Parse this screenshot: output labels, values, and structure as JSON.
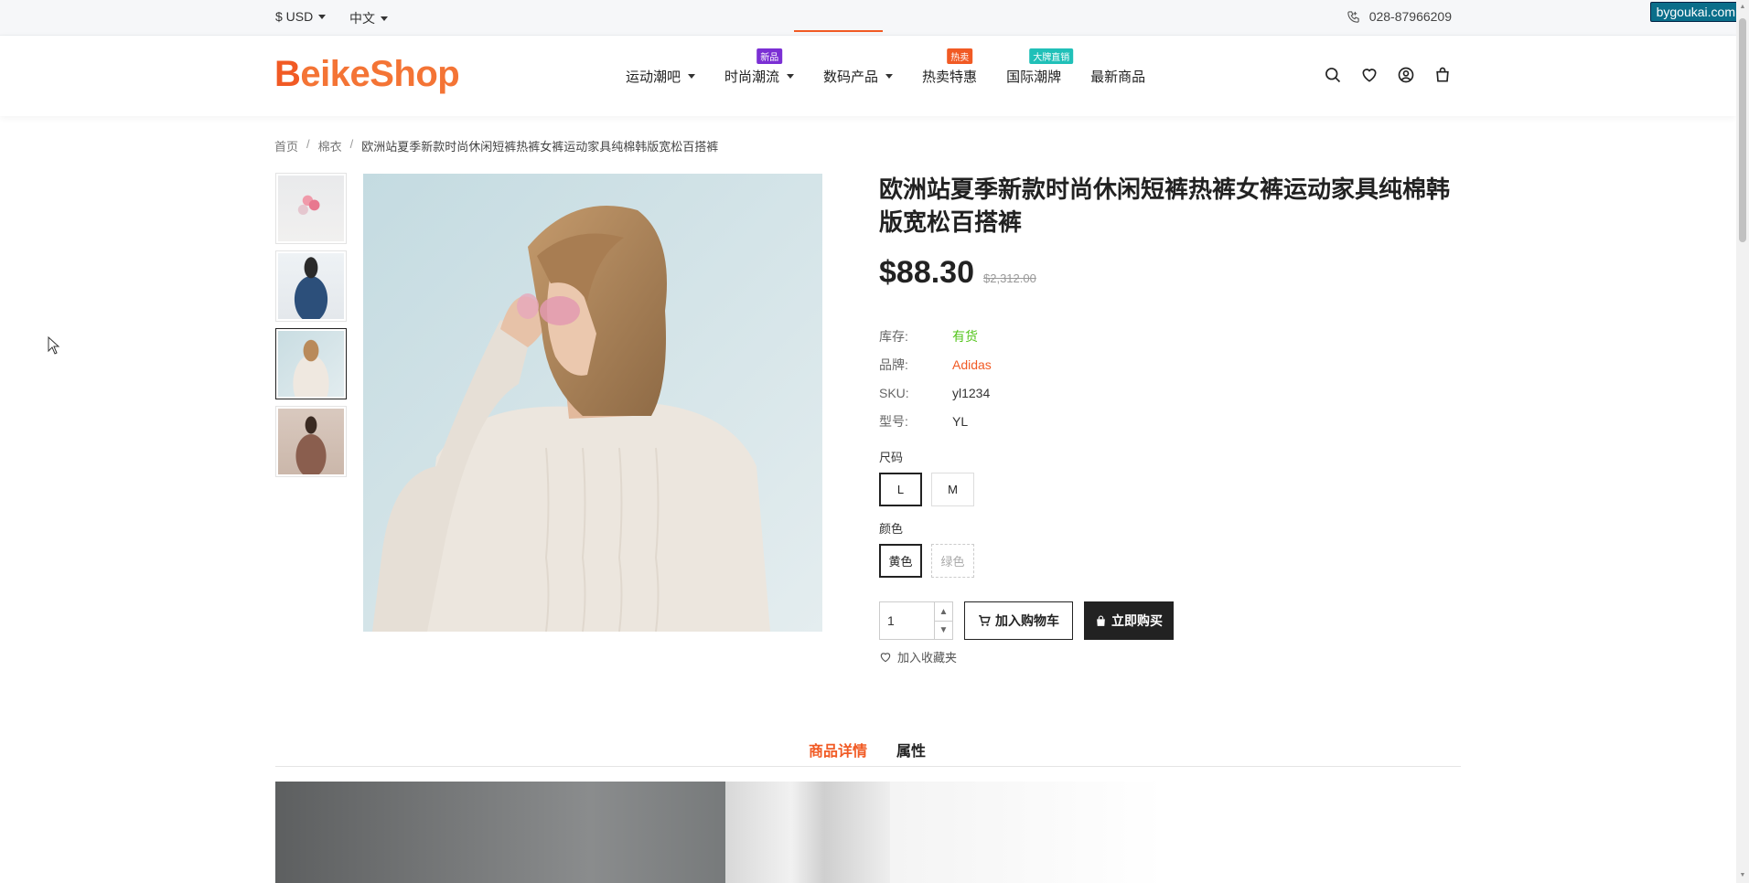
{
  "topbar": {
    "currency": "$ USD",
    "language": "中文",
    "phone": "028-87966209",
    "watermark": "bygoukai.com"
  },
  "header": {
    "logo_part1": "B",
    "logo_part2": "eikeShop",
    "nav": [
      {
        "label": "运动潮吧",
        "has_dropdown": true,
        "badge": ""
      },
      {
        "label": "时尚潮流",
        "has_dropdown": true,
        "badge": "新品",
        "badge_color": "#7b2fd4"
      },
      {
        "label": "数码产品",
        "has_dropdown": true,
        "badge": ""
      },
      {
        "label": "热卖特惠",
        "has_dropdown": false,
        "badge": "热卖",
        "badge_color": "#f15a24"
      },
      {
        "label": "国际潮牌",
        "has_dropdown": false,
        "badge": "大牌直销",
        "badge_color": "#20c0b8"
      },
      {
        "label": "最新商品",
        "has_dropdown": false,
        "badge": ""
      }
    ],
    "icons": [
      "search-icon",
      "heart-icon",
      "user-icon",
      "cart-icon"
    ]
  },
  "breadcrumb": [
    "首页",
    "棉衣",
    "欧洲站夏季新款时尚休闲短裤热裤女裤运动家具纯棉韩版宽松百搭裤"
  ],
  "product": {
    "title": "欧洲站夏季新款时尚休闲短裤热裤女裤运动家具纯棉韩版宽松百搭裤",
    "price": "$88.30",
    "old_price": "$2,312.00",
    "specs": [
      {
        "key": "库存:",
        "value": "有货",
        "color": "#52c41a"
      },
      {
        "key": "品牌:",
        "value": "Adidas",
        "color": "#f15a24"
      },
      {
        "key": "SKU:",
        "value": "yl1234",
        "color": "#333333"
      },
      {
        "key": "型号:",
        "value": "YL",
        "color": "#333333"
      }
    ],
    "size_label": "尺码",
    "sizes": [
      "L",
      "M"
    ],
    "color_label": "颜色",
    "colors": [
      "黄色",
      "绿色"
    ],
    "quantity": "1",
    "add_to_cart": "加入购物车",
    "buy_now": "立即购买",
    "add_favorite": "加入收藏夹"
  },
  "tabs": [
    "商品详情",
    "属性"
  ],
  "colors": {
    "accent": "#f15a24",
    "dark": "#222222"
  }
}
